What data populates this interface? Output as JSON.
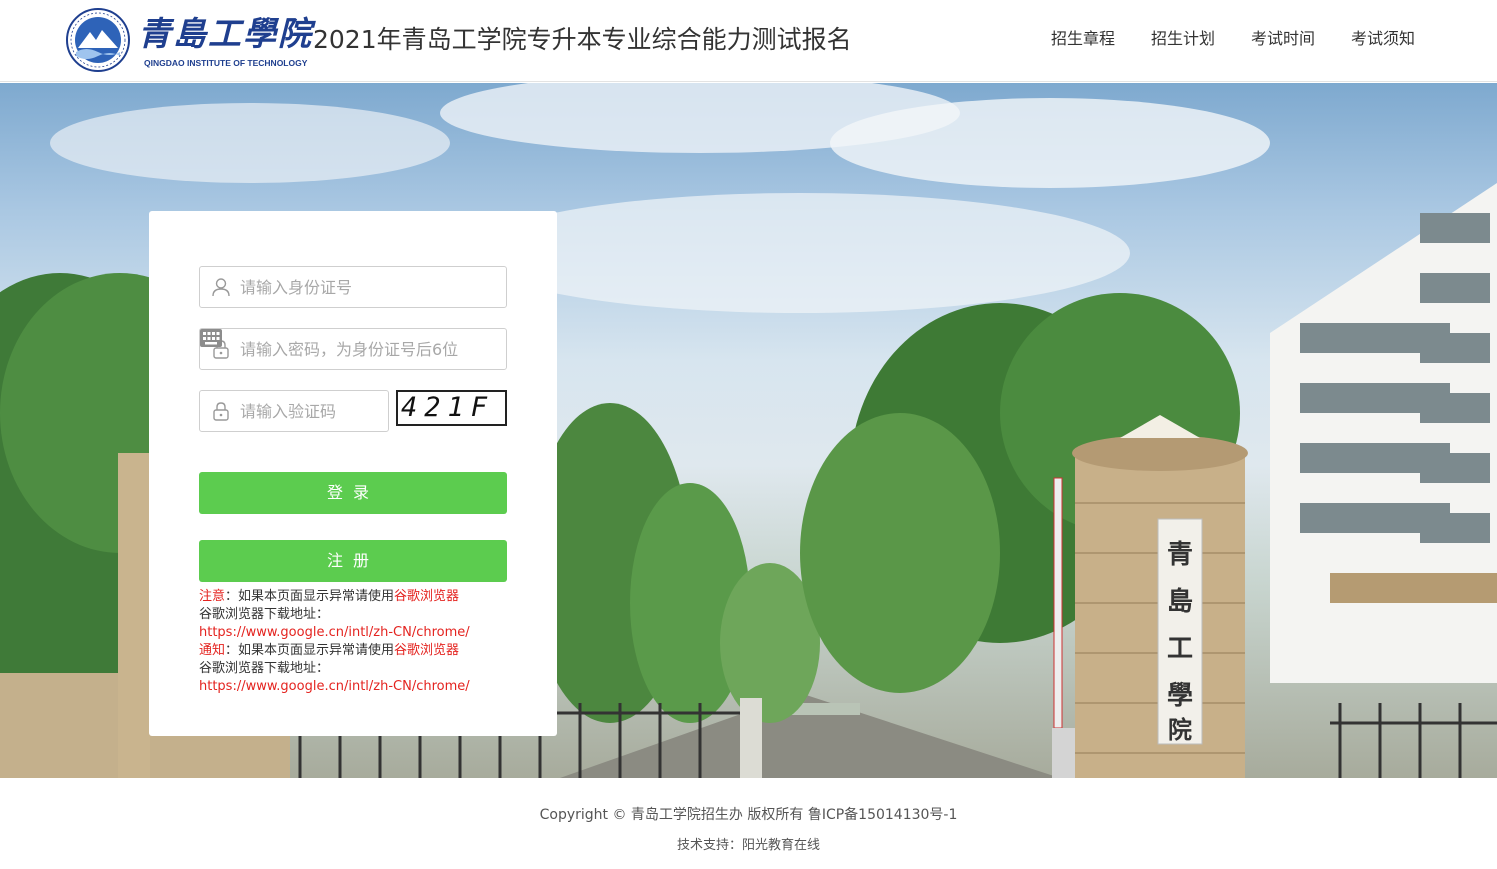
{
  "header": {
    "brand_cn": "青島工學院",
    "brand_en": "QINGDAO INSTITUTE OF TECHNOLOGY",
    "title": "2021年青岛工学院专升本专业综合能力测试报名",
    "nav": [
      {
        "label": "招生章程"
      },
      {
        "label": "招生计划"
      },
      {
        "label": "考试时间"
      },
      {
        "label": "考试须知"
      }
    ]
  },
  "gate_sign": "青島工學院",
  "login": {
    "id_placeholder": "请输入身份证号",
    "password_placeholder": "请输入密码，为身份证号后6位",
    "captcha_placeholder": "请输入验证码",
    "captcha_text": "421F",
    "login_label": "登录",
    "register_label": "注册",
    "notice1_prefix": "注意",
    "notice1_text": "：如果本页面显示异常请使用",
    "notice1_link": "谷歌浏览器",
    "download_label": "谷歌浏览器下载地址：",
    "download_url1": "https://www.google.cn/intl/zh-CN/chrome/",
    "notice2_prefix": "通知",
    "notice2_text": "：如果本页面显示异常请使用",
    "notice2_link": "谷歌浏览器",
    "download_label2": "谷歌浏览器下载地址：",
    "download_url2": "https://www.google.cn/intl/zh-CN/chrome/"
  },
  "footer": {
    "copyright": "Copyright © 青岛工学院招生办 版权所有 鲁ICP备15014130号-1",
    "support": "技术支持：阳光教育在线"
  },
  "colors": {
    "accent_green": "#5ccc4f",
    "notice_red": "#e4231f",
    "brand_blue": "#1f3f8f"
  },
  "icons": {
    "id_field": "user-icon",
    "password_field": "lock-icon",
    "captcha_field": "lock-icon",
    "keyboard": "keyboard-icon"
  }
}
